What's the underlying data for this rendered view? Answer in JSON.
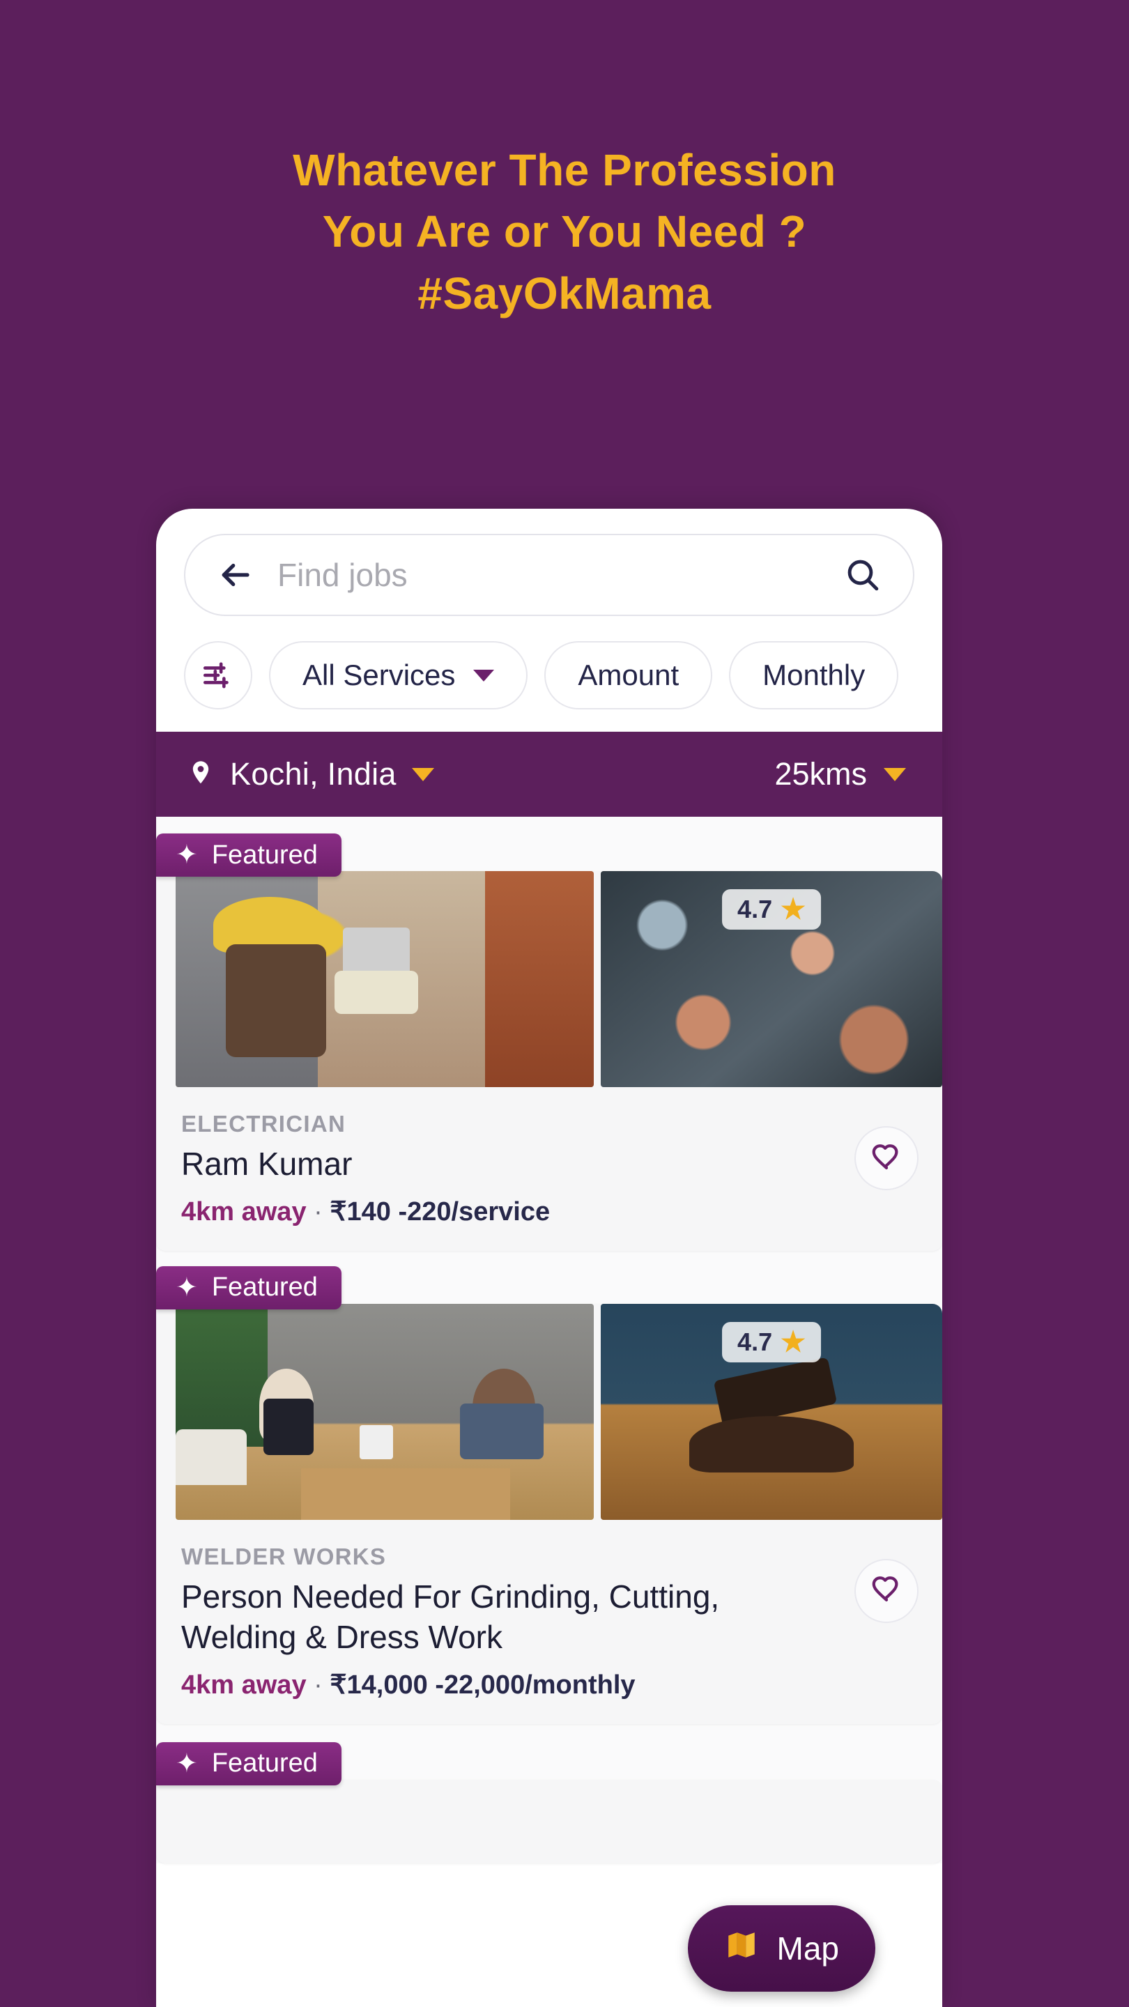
{
  "hero": {
    "line1": "Whatever The Profession",
    "line2": "You Are or You Need ?",
    "line3": "#SayOkMama",
    "accent_color": "#F5B323",
    "background_color": "#5C1F5C"
  },
  "search": {
    "placeholder": "Find jobs",
    "back_icon": "back-arrow-icon",
    "search_icon": "search-icon"
  },
  "filters": {
    "filter_icon": "sliders-filter-icon",
    "chips": [
      {
        "label": "All Services",
        "has_caret": true
      },
      {
        "label": "Amount",
        "has_caret": false
      },
      {
        "label": "Monthly",
        "has_caret": false
      }
    ]
  },
  "location": {
    "pin_icon": "location-pin-icon",
    "place": "Kochi, India",
    "radius": "25kms"
  },
  "listings": [
    {
      "badge": "Featured",
      "badge_icon": "sparkle-icon",
      "rating": "4.7",
      "star_icon": "star-icon",
      "category": "ELECTRICIAN",
      "title": "Ram Kumar",
      "distance": "4km away",
      "separator": "·",
      "price": "₹140 -220/service",
      "fav_icon": "heart-outline-icon"
    },
    {
      "badge": "Featured",
      "badge_icon": "sparkle-icon",
      "rating": "4.7",
      "star_icon": "star-icon",
      "category": "WELDER WORKS",
      "title": "Person Needed For Grinding, Cutting, Welding & Dress Work",
      "distance": "4km away",
      "separator": "·",
      "price": "₹14,000 -22,000/monthly",
      "fav_icon": "heart-outline-icon"
    },
    {
      "badge": "Featured",
      "badge_icon": "sparkle-icon"
    }
  ],
  "map_button": {
    "label": "Map",
    "icon": "folded-map-icon"
  },
  "colors": {
    "purple": "#5C1F5C",
    "gold": "#F5B323",
    "navy": "#232447",
    "magenta": "#8A2470"
  }
}
